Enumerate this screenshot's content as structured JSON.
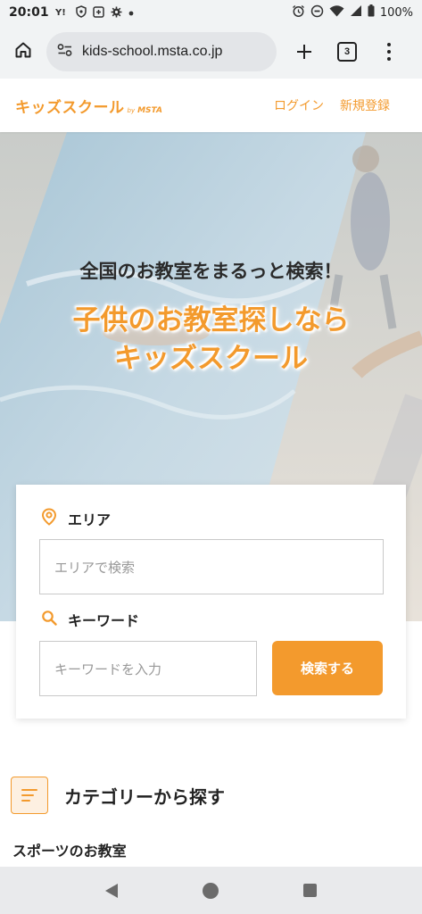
{
  "status_bar": {
    "time": "20:01",
    "battery": "100%",
    "left_icons": [
      "yahoo-icon",
      "shield-icon",
      "media-icon",
      "gear-icon",
      "dot-icon"
    ],
    "right_icons": [
      "alarm-icon",
      "dnd-icon",
      "wifi-icon",
      "signal-icon",
      "battery-icon"
    ]
  },
  "browser": {
    "url": "kids-school.msta.co.jp",
    "tab_count": "3"
  },
  "site_header": {
    "logo_main": "キッズスクール",
    "logo_by": "by",
    "logo_brand": "MSTA",
    "login_link": "ログイン",
    "register_link": "新規登録"
  },
  "hero": {
    "title": "全国のお教室をまるっと検索！",
    "catch_line1": "子供のお教室探しなら",
    "catch_line2": "キッズスクール"
  },
  "search": {
    "area_label": "エリア",
    "area_placeholder": "エリアで検索",
    "keyword_label": "キーワード",
    "keyword_placeholder": "キーワードを入力",
    "button_label": "検索する"
  },
  "category": {
    "heading": "カテゴリーから探す",
    "sports_heading": "スポーツのお教室"
  },
  "colors": {
    "accent": "#f39a2d",
    "browser_bg": "#f1f3f4"
  }
}
